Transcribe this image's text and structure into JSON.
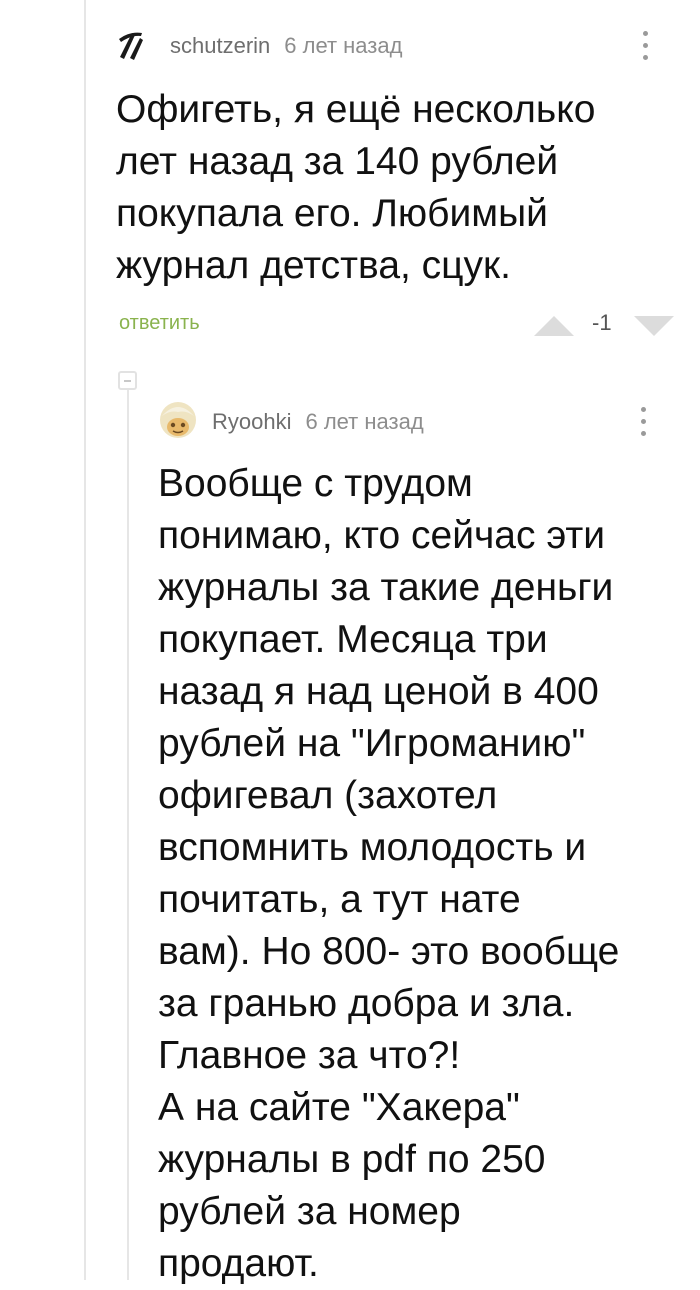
{
  "comments": [
    {
      "username": "schutzerin",
      "time": "6 лет назад",
      "text": "Офигеть, я ещё несколько\nлет назад за 140 рублей\nпокупала его. Любимый\nжурнал детства, сцук.",
      "reply_label": "ответить",
      "rating": "-1",
      "avatar_icon": "claw-marks-icon",
      "more_icon": "vertical-ellipsis-icon"
    },
    {
      "username": "Ryoohki",
      "time": "6 лет назад",
      "text": "Вообще с трудом\nпонимаю, кто сейчас эти\nжурналы за такие деньги\nпокупает. Месяца три\nназад я над ценой в 400\nрублей на \"Игроманию\"\nофигевал (захотел\nвспомнить молодость и\nпочитать, а тут нате\nвам). Но 800- это вообще\nза гранью добра и зла.\nГлавное за что?!\nА на сайте \"Хакера\"\nжурналы в pdf по 250\nрублей за номер\nпродают.",
      "avatar_icon": "cartoon-face-icon",
      "more_icon": "vertical-ellipsis-icon"
    }
  ],
  "colors": {
    "reply_link": "#8ab34e",
    "thread_line": "#e6e6e6",
    "rating_arrow": "#dcdcdc"
  }
}
